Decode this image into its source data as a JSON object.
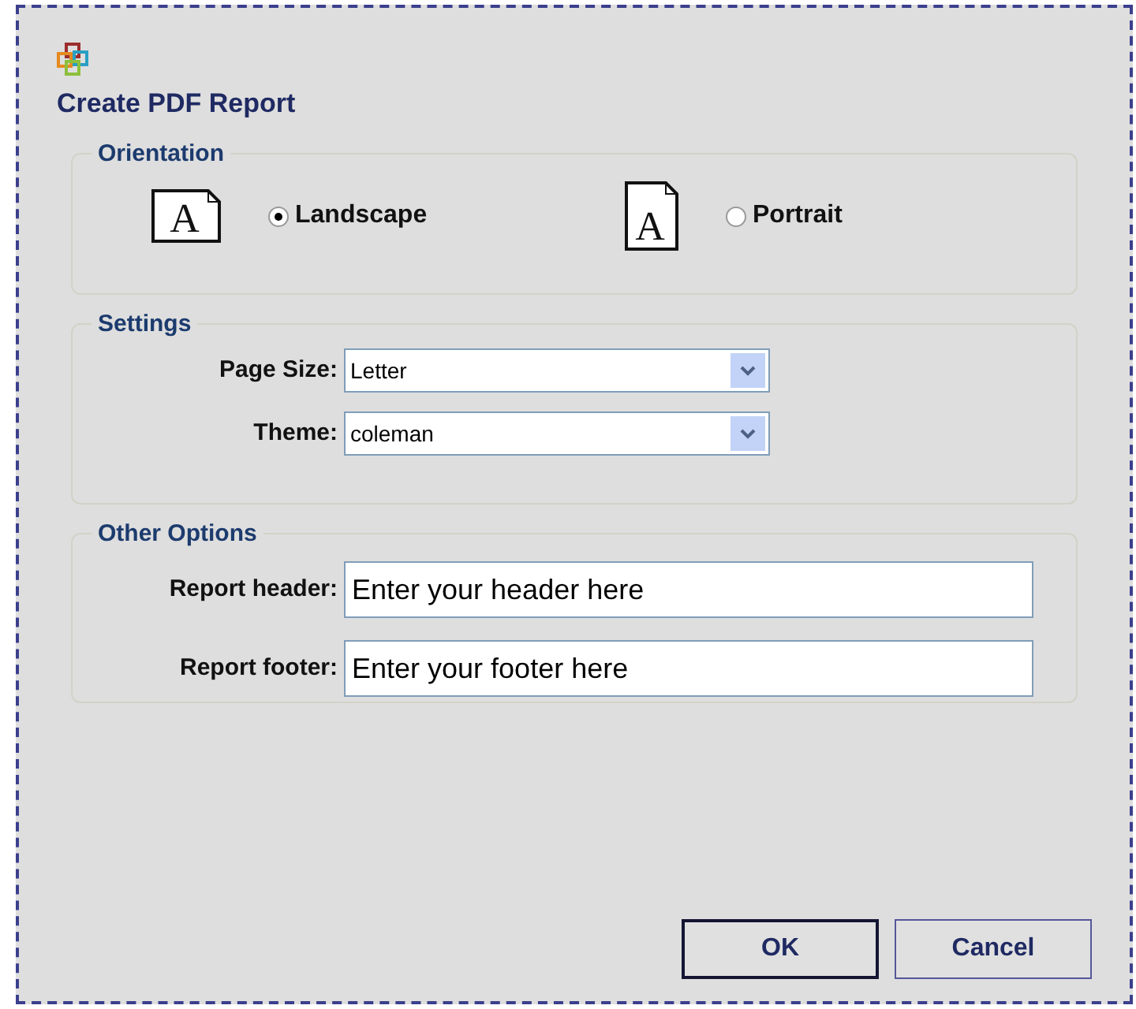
{
  "window": {
    "title": "Create PDF Report"
  },
  "orientation": {
    "legend": "Orientation",
    "options": [
      {
        "label": "Landscape",
        "kind": "landscape",
        "icon_letter": "A",
        "selected": true
      },
      {
        "label": "Portrait",
        "kind": "portrait",
        "icon_letter": "A",
        "selected": false
      }
    ]
  },
  "settings": {
    "legend": "Settings",
    "fields": [
      {
        "label": "Page Size:",
        "value": "Letter"
      },
      {
        "label": "Theme:",
        "value": "coleman"
      }
    ]
  },
  "other_options": {
    "legend": "Other Options",
    "fields": [
      {
        "label": "Report header:",
        "value": "Enter your header here"
      },
      {
        "label": "Report footer:",
        "value": "Enter your footer here"
      }
    ]
  },
  "buttons": [
    {
      "label": "OK",
      "default": true
    },
    {
      "label": "Cancel",
      "default": false
    }
  ]
}
